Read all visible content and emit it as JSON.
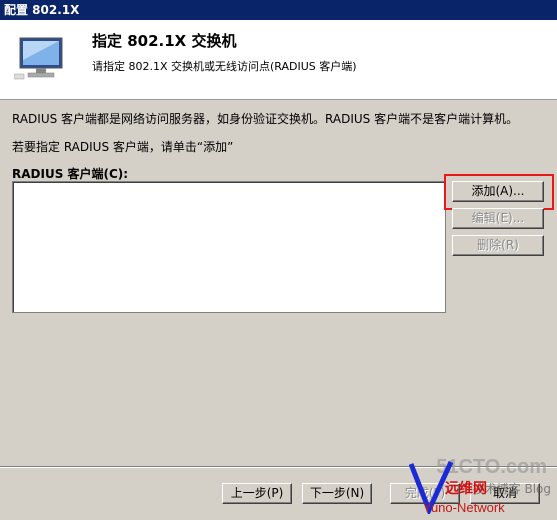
{
  "window": {
    "title": "配置 802.1X"
  },
  "header": {
    "title": "指定 802.1X 交换机",
    "subtitle": "请指定 802.1X 交换机或无线访问点(RADIUS 客户端)"
  },
  "body": {
    "description": "RADIUS 客户端都是网络访问服务器，如身份验证交换机。RADIUS 客户端不是客户端计算机。",
    "instruction": "若要指定 RADIUS 客户端，请单击“添加”",
    "list_label": "RADIUS 客户端(C):",
    "clients": []
  },
  "side_buttons": {
    "add": "添加(A)...",
    "edit": "编辑(E)...",
    "remove": "删除(R)"
  },
  "footer": {
    "back": "上一步(P)",
    "next": "下一步(N)",
    "finish": "完成(F)",
    "cancel": "取消"
  },
  "watermark": {
    "site": "51CTO.com",
    "sub": "技术博客 Blog",
    "brand": "远维网",
    "brand_en": "Yuno-Network"
  },
  "colors": {
    "title_bar": "#0a246a",
    "dialog_bg": "#d4d0c8",
    "highlight_box": "#e8181a"
  }
}
